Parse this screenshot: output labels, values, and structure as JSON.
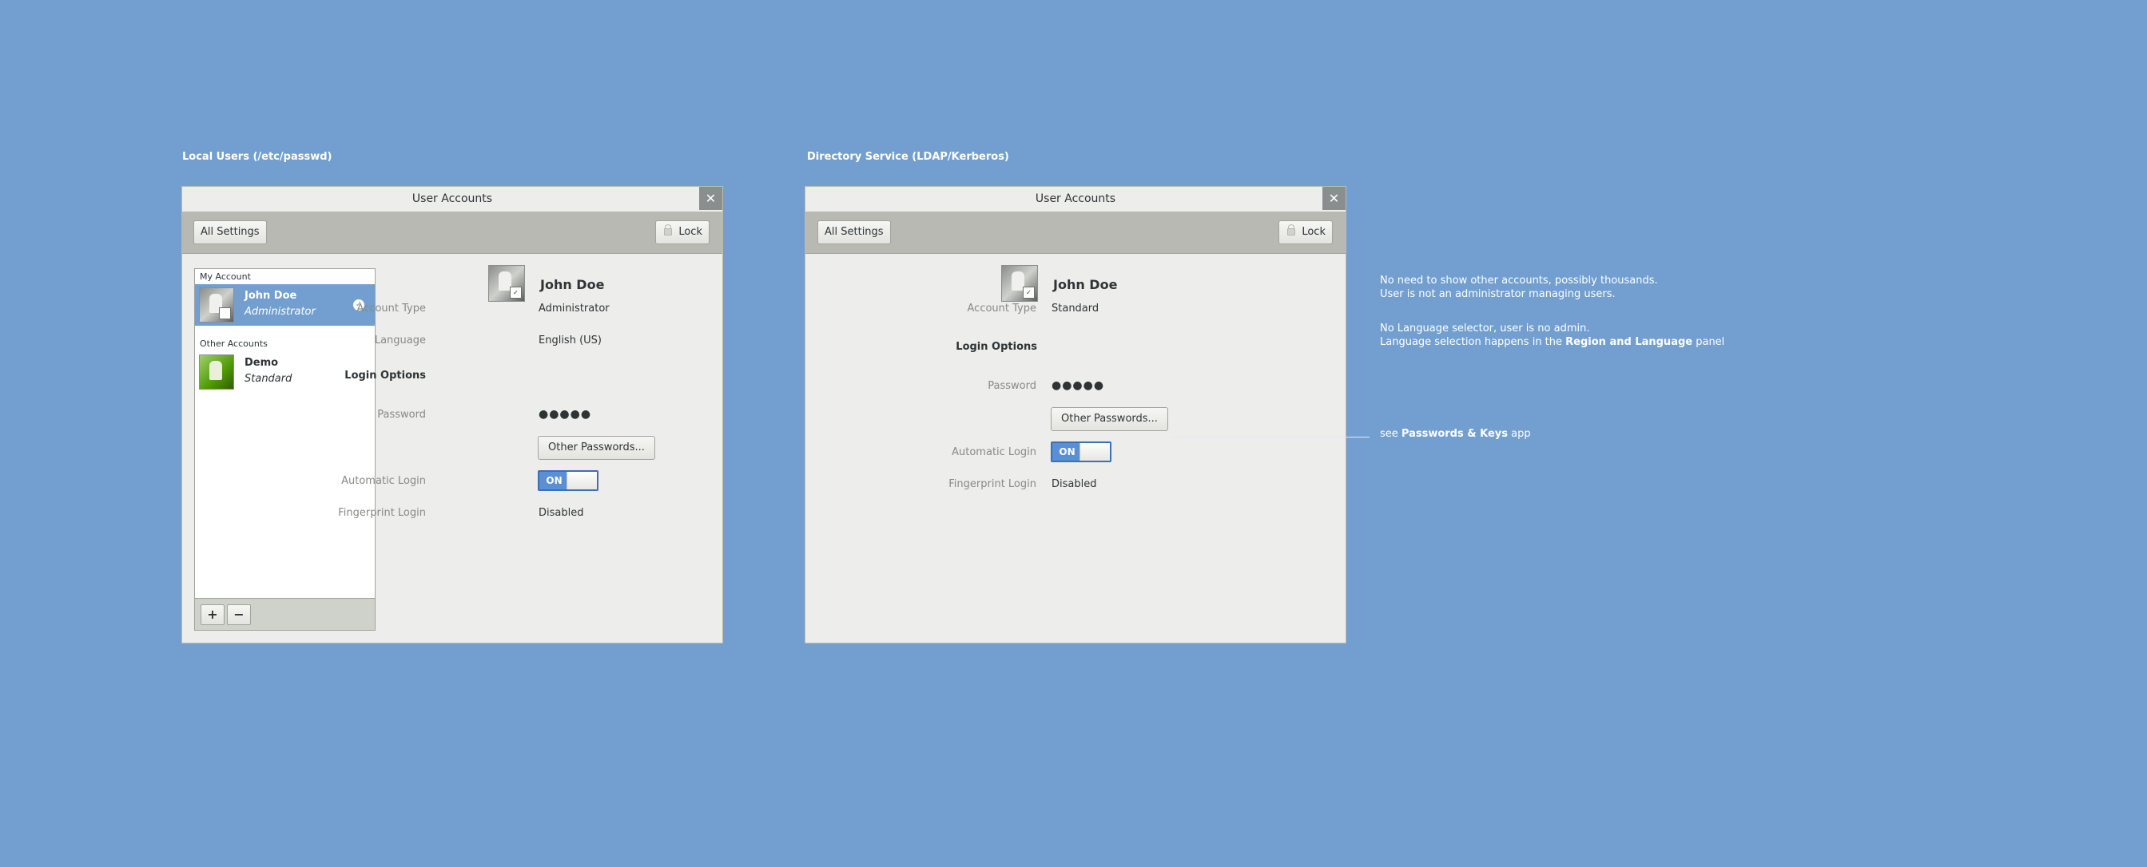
{
  "sections": {
    "local_title": "Local Users (/etc/passwd)",
    "directory_title": "Directory Service (LDAP/Kerberos)"
  },
  "window_local": {
    "title": "User Accounts",
    "close_glyph": "✕",
    "all_settings": "All Settings",
    "lock": "Lock",
    "list": {
      "my_account_header": "My Account",
      "current_user": {
        "name": "John Doe",
        "role": "Administrator",
        "check_glyph": "✓"
      },
      "other_accounts_header": "Other Accounts",
      "other_user": {
        "name": "Demo",
        "role": "Standard"
      },
      "add_glyph": "+",
      "remove_glyph": "−"
    },
    "detail": {
      "name": "John Doe",
      "account_type_label": "Account Type",
      "account_type_value": "Administrator",
      "language_label": "Language",
      "language_value": "English (US)",
      "login_options": "Login Options",
      "password_label": "Password",
      "password_value": "●●●●●",
      "other_passwords": "Other Passwords...",
      "automatic_login_label": "Automatic Login",
      "switch_on": "ON",
      "fingerprint_label": "Fingerprint Login",
      "fingerprint_value": "Disabled"
    }
  },
  "window_directory": {
    "title": "User Accounts",
    "close_glyph": "✕",
    "all_settings": "All Settings",
    "lock": "Lock",
    "detail": {
      "name": "John Doe",
      "account_type_label": "Account Type",
      "account_type_value": "Standard",
      "login_options": "Login Options",
      "password_label": "Password",
      "password_value": "●●●●●",
      "other_passwords": "Other Passwords...",
      "automatic_login_label": "Automatic Login",
      "switch_on": "ON",
      "fingerprint_label": "Fingerprint Login",
      "fingerprint_value": "Disabled"
    }
  },
  "notes": {
    "accounts_line1": "No need to show other accounts, possibly thousands.",
    "accounts_line2": "User is not an administrator managing users.",
    "language_line1": "No Language selector, user is no admin.",
    "language_line2_pre": "Language selection happens in the ",
    "language_line2_bold": "Region and Language",
    "language_line2_post": " panel",
    "passwords_pre": "see ",
    "passwords_bold": "Passwords & Keys",
    "passwords_post": " app"
  },
  "colors": {
    "background": "#729fcf",
    "selection": "#729fcf",
    "switch_on": "#5a8fd6"
  }
}
